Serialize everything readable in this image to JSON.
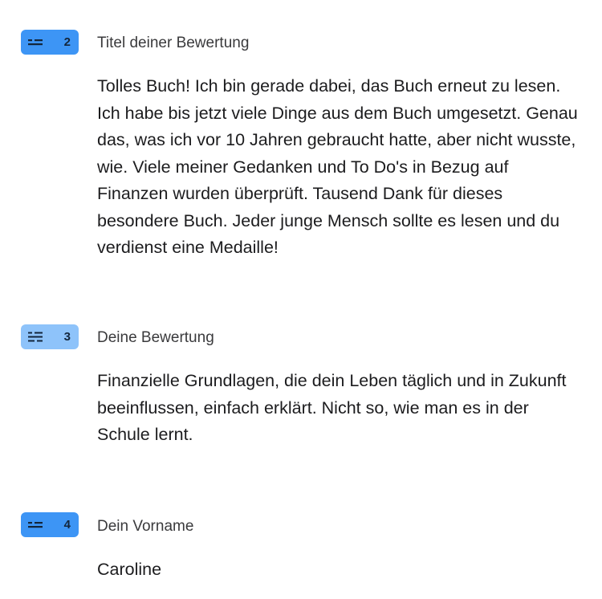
{
  "fields": [
    {
      "number": "2",
      "icon": "short-text-icon",
      "label": "Titel deiner Bewertung",
      "answer": "Tolles Buch! Ich bin gerade dabei, das Buch erneut zu lesen. Ich habe bis jetzt viele Dinge aus dem Buch umgesetzt. Genau das, was ich vor 10 Jahren gebraucht hatte, aber nicht wusste, wie. Viele meiner Gedanken und To Do's in Bezug auf Finanzen wurden überprüft. Tausend Dank für dieses besondere Buch. Jeder junge Mensch sollte es lesen und du verdienst eine Medaille!",
      "badge_color": "#3d95f5"
    },
    {
      "number": "3",
      "icon": "long-text-icon",
      "label": "Deine Bewertung",
      "answer": "Finanzielle Grundlagen, die dein Leben täglich und in Zukunft beeinflussen, einfach erklärt. Nicht so, wie man es in der Schule lernt.",
      "badge_color": "#8ec3fa"
    },
    {
      "number": "4",
      "icon": "short-text-icon",
      "label": "Dein Vorname",
      "answer": "Caroline",
      "badge_color": "#3d95f5"
    }
  ]
}
